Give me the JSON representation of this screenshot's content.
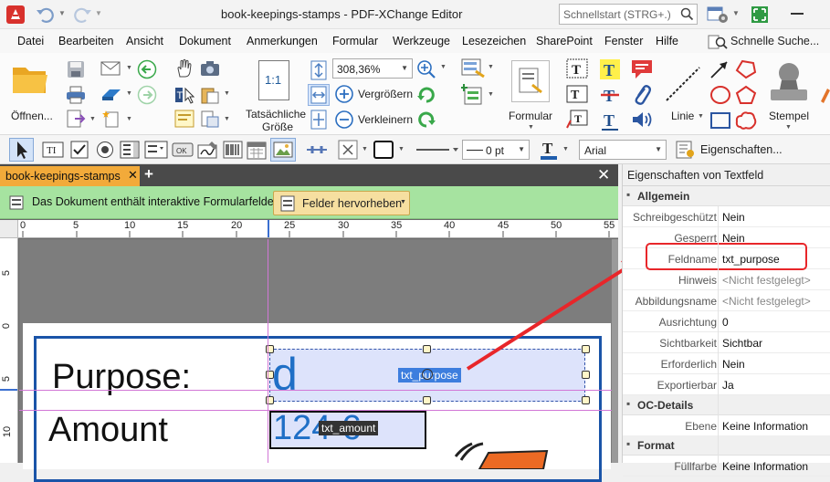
{
  "window": {
    "title": "book-keepings-stamps - PDF-XChange Editor",
    "quick_search_placeholder": "Schnellstart (STRG+.)"
  },
  "menu": {
    "items": [
      "Datei",
      "Bearbeiten",
      "Ansicht",
      "Dokument",
      "Anmerkungen",
      "Formular",
      "Werkzeuge",
      "Lesezeichen",
      "SharePoint",
      "Fenster",
      "Hilfe"
    ],
    "quick_search": "Schnelle Suche..."
  },
  "ribbon": {
    "open_label": "Öffnen...",
    "actual_size_label_1": "Tatsächliche",
    "actual_size_label_2": "Größe",
    "zoom_value": "308,36%",
    "zoom_in_label": "Vergrößern",
    "zoom_out_label": "Verkleinern",
    "form_label": "Formular",
    "line_label": "Linie",
    "stamp_label": "Stempel",
    "actual_size_icon_text": "1:1"
  },
  "props_toolbar": {
    "stroke_width": "0 pt",
    "font": "Arial",
    "properties_label": "Eigenschaften..."
  },
  "document": {
    "tab_title": "book-keepings-stamps",
    "notice_text": "Das Dokument enthält interaktive Formularfelder.",
    "highlight_fields_label": "Felder hervorheben",
    "ruler_top": [
      "0",
      "5",
      "10",
      "15",
      "20",
      "25",
      "30",
      "35",
      "40",
      "45",
      "50",
      "55"
    ],
    "ruler_left": [
      "5",
      "0",
      "5",
      "10"
    ],
    "form_label_purpose": "Purpose:",
    "form_label_amount": "Amount",
    "field_purpose_value": "d",
    "field_purpose_name": "txt_purpose",
    "field_amount_value": "124 €",
    "field_amount_name": "txt_amount"
  },
  "properties_panel": {
    "title": "Eigenschaften von Textfeld",
    "sections": [
      {
        "title": "Allgemein",
        "rows": [
          {
            "key": "Schreibgeschützt",
            "value": "Nein"
          },
          {
            "key": "Gesperrt",
            "value": "Nein"
          },
          {
            "key": "Feldname",
            "value": "txt_purpose"
          },
          {
            "key": "Hinweis",
            "value": "<Nicht festgelegt>"
          },
          {
            "key": "Abbildungsname",
            "value": "<Nicht festgelegt>"
          },
          {
            "key": "Ausrichtung",
            "value": "0"
          },
          {
            "key": "Sichtbarkeit",
            "value": "Sichtbar"
          },
          {
            "key": "Erforderlich",
            "value": "Nein"
          },
          {
            "key": "Exportierbar",
            "value": "Ja"
          }
        ]
      },
      {
        "title": "OC-Details",
        "rows": [
          {
            "key": "Ebene",
            "value": "Keine Information"
          }
        ]
      },
      {
        "title": "Format",
        "rows": [
          {
            "key": "Füllfarbe",
            "value": "Keine Information"
          }
        ]
      }
    ]
  },
  "colors": {
    "accent_red": "#e8262a",
    "tab_orange": "#f2aa3a",
    "notice_green": "#a6e3a0",
    "field_blue": "#1f6fc6",
    "frame_blue": "#1a54a8"
  }
}
